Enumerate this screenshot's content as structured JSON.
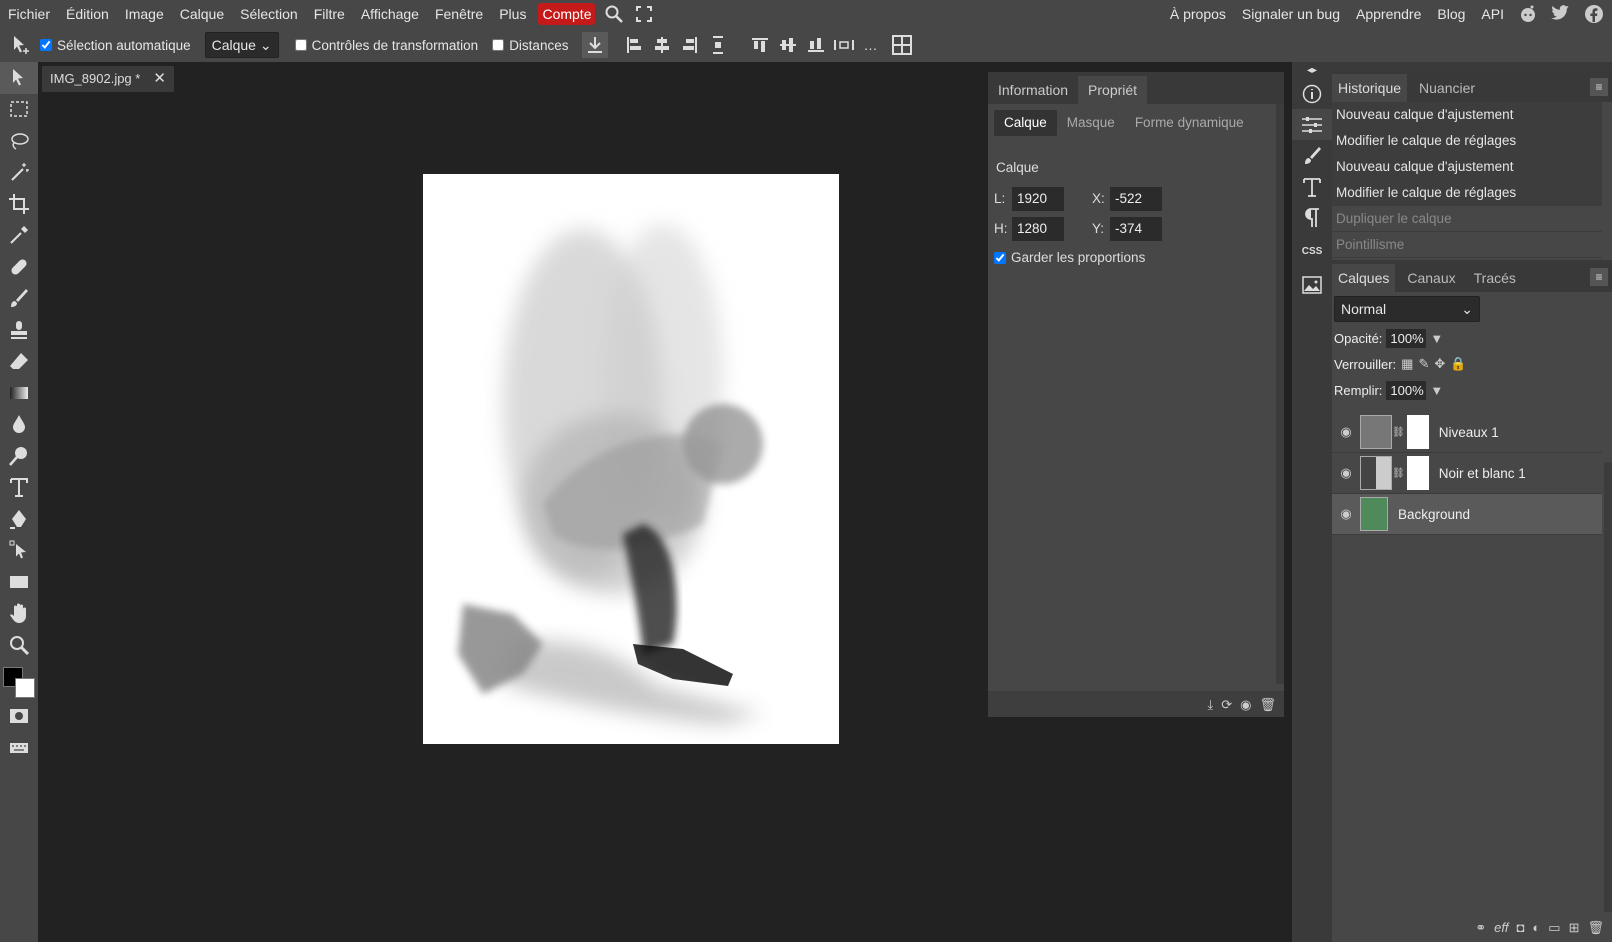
{
  "menu": {
    "items": [
      "Fichier",
      "Édition",
      "Image",
      "Calque",
      "Sélection",
      "Filtre",
      "Affichage",
      "Fenêtre",
      "Plus"
    ],
    "compte": "Compte",
    "right": [
      "À propos",
      "Signaler un bug",
      "Apprendre",
      "Blog",
      "API"
    ]
  },
  "options": {
    "auto_select": "Sélection automatique",
    "mode": "Calque",
    "transform": "Contrôles de transformation",
    "distances": "Distances"
  },
  "doc": {
    "tab": "IMG_8902.jpg *"
  },
  "properties": {
    "tabs": [
      "Information",
      "Propriét"
    ],
    "subtabs": [
      "Calque",
      "Masque",
      "Forme dynamique"
    ],
    "section": "Calque",
    "w_label": "L:",
    "w": "1920",
    "x_label": "X:",
    "x": "-522",
    "h_label": "H:",
    "h": "1280",
    "y_label": "Y:",
    "y": "-374",
    "keep": "Garder les proportions"
  },
  "history": {
    "tabs": [
      "Historique",
      "Nuancier"
    ],
    "items": [
      "Nouveau calque d'ajustement",
      "Modifier le calque de réglages",
      "Nouveau calque d'ajustement",
      "Modifier le calque de réglages",
      "Dupliquer le calque",
      "Pointillisme"
    ]
  },
  "layers": {
    "tabs": [
      "Calques",
      "Canaux",
      "Tracés"
    ],
    "blend": "Normal",
    "opacity_label": "Opacité:",
    "opacity": "100%",
    "lock_label": "Verrouiller:",
    "fill_label": "Remplir:",
    "fill": "100%",
    "items": [
      "Niveaux 1",
      "Noir et blanc 1",
      "Background"
    ]
  },
  "strip": {
    "css": "CSS"
  }
}
